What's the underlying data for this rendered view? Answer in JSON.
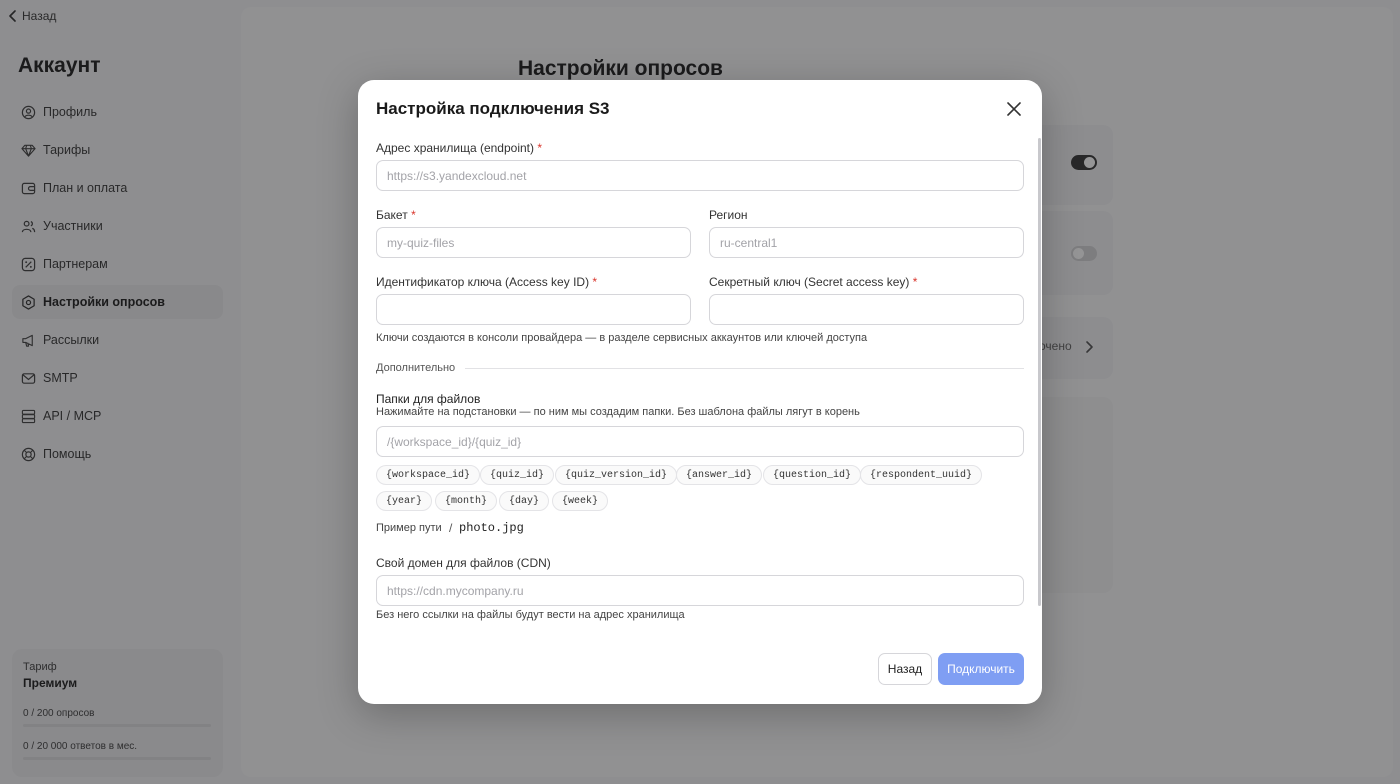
{
  "sidebar": {
    "back_label": "Назад",
    "title": "Аккаунт",
    "items": [
      {
        "label": "Профиль",
        "icon": "user-circle-icon",
        "active": false
      },
      {
        "label": "Тарифы",
        "icon": "diamond-icon",
        "active": false
      },
      {
        "label": "План и оплата",
        "icon": "wallet-icon",
        "active": false
      },
      {
        "label": "Участники",
        "icon": "users-icon",
        "active": false
      },
      {
        "label": "Партнерам",
        "icon": "percent-icon",
        "active": false
      },
      {
        "label": "Настройки опросов",
        "icon": "hexagon-settings-icon",
        "active": true
      },
      {
        "label": "Рассылки",
        "icon": "megaphone-icon",
        "active": false
      },
      {
        "label": "SMTP",
        "icon": "mail-icon",
        "active": false
      },
      {
        "label": "API / MCP",
        "icon": "server-icon",
        "active": false
      },
      {
        "label": "Помощь",
        "icon": "lifebuoy-icon",
        "active": false
      }
    ],
    "plan": {
      "label": "Тариф",
      "name": "Премиум",
      "usage": [
        {
          "text": "0 / 200 опросов",
          "fraction": 0
        },
        {
          "text": "0 / 20 000 ответов в мес.",
          "fraction": 0
        }
      ]
    }
  },
  "main": {
    "title": "Настройки опросов",
    "partial_status_text": "очено"
  },
  "modal": {
    "title": "Настройка подключения S3",
    "endpoint": {
      "label": "Адрес хранилища (endpoint)",
      "required_mark": "*",
      "placeholder": "https://s3.yandexcloud.net",
      "value": ""
    },
    "bucket": {
      "label": "Бакет",
      "required_mark": "*",
      "placeholder": "my-quiz-files",
      "value": ""
    },
    "region": {
      "label": "Регион",
      "placeholder": "ru-central1",
      "value": ""
    },
    "access_key": {
      "label": "Идентификатор ключа (Access key ID)",
      "required_mark": "*",
      "value": ""
    },
    "secret_key": {
      "label": "Секретный ключ (Secret access key)",
      "required_mark": "*",
      "value": ""
    },
    "keys_hint": "Ключи создаются в консоли провайдера — в разделе сервисных аккаунтов или ключей доступа",
    "section_label": "Дополнительно",
    "folders": {
      "title": "Папки для файлов",
      "hint": "Нажимайте на подстановки — по ним мы создадим папки. Без шаблона файлы лягут в корень",
      "placeholder": "/{workspace_id}/{quiz_id}",
      "value": "",
      "chips_row1": [
        "{workspace_id}",
        "{quiz_id}",
        "{quiz_version_id}",
        "{answer_id}",
        "{question_id}",
        "{respondent_uuid}"
      ],
      "chips_row2": [
        "{year}",
        "{month}",
        "{day}",
        "{week}"
      ]
    },
    "path_example": {
      "label": "Пример пути",
      "separator": "/",
      "value": "photo.jpg"
    },
    "cdn": {
      "label": "Свой домен для файлов (CDN)",
      "placeholder": "https://cdn.mycompany.ru",
      "value": "",
      "hint": "Без него ссылки на файлы будут вести на адрес хранилища"
    },
    "buttons": {
      "back": "Назад",
      "connect": "Подключить"
    },
    "accent_color": "#7f9ef3"
  }
}
